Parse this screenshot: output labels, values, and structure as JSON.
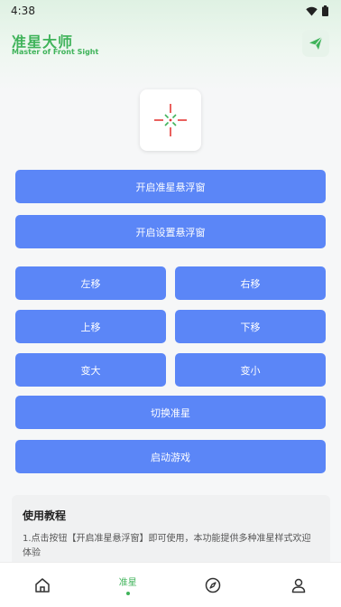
{
  "status_bar": {
    "time": "4:38"
  },
  "header": {
    "title": "准星大师",
    "subtitle": "Master of Front Sight",
    "send_icon": "send-icon"
  },
  "preview": {
    "icon": "crosshair-icon"
  },
  "buttons": {
    "open_crosshair_float": "开启准星悬浮窗",
    "open_settings_float": "开启设置悬浮窗",
    "move_left": "左移",
    "move_right": "右移",
    "move_up": "上移",
    "move_down": "下移",
    "enlarge": "变大",
    "shrink": "变小",
    "switch_crosshair": "切换准星",
    "launch_game": "启动游戏"
  },
  "tutorial": {
    "title": "使用教程",
    "text": "1.点击按钮【开启准星悬浮窗】即可使用，本功能提供多种准星样式欢迎体验"
  },
  "bottom_nav": {
    "items": [
      {
        "icon": "home-icon",
        "label": ""
      },
      {
        "icon": "crosshair-tab",
        "label": "准星",
        "active": true
      },
      {
        "icon": "compass-icon",
        "label": ""
      },
      {
        "icon": "user-icon",
        "label": ""
      }
    ]
  },
  "colors": {
    "accent_green": "#3fb35a",
    "button_blue": "#5b86f7"
  }
}
